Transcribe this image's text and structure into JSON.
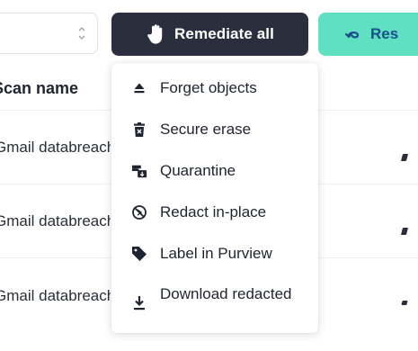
{
  "toolbar": {
    "remediate_label": "Remediate all",
    "restore_label": "Res"
  },
  "table": {
    "header": "Scan name",
    "rows": [
      {
        "name": "Gmail databreach"
      },
      {
        "name": "Gmail databreach"
      },
      {
        "name": "Gmail databreach"
      }
    ]
  },
  "remediate_menu": {
    "items": [
      {
        "label": "Forget objects",
        "icon": "eject-icon"
      },
      {
        "label": "Secure erase",
        "icon": "trash-x-icon"
      },
      {
        "label": "Quarantine",
        "icon": "truck-box-icon"
      },
      {
        "label": "Redact in-place",
        "icon": "slash-circle-icon"
      },
      {
        "label": "Label in Purview",
        "icon": "tag-icon"
      },
      {
        "label": "Download redacted",
        "icon": "download-icon"
      }
    ]
  },
  "colors": {
    "primary_dark": "#2b2f3d",
    "accent_teal": "#5fe0c2",
    "accent_blue": "#1a4f8a"
  }
}
